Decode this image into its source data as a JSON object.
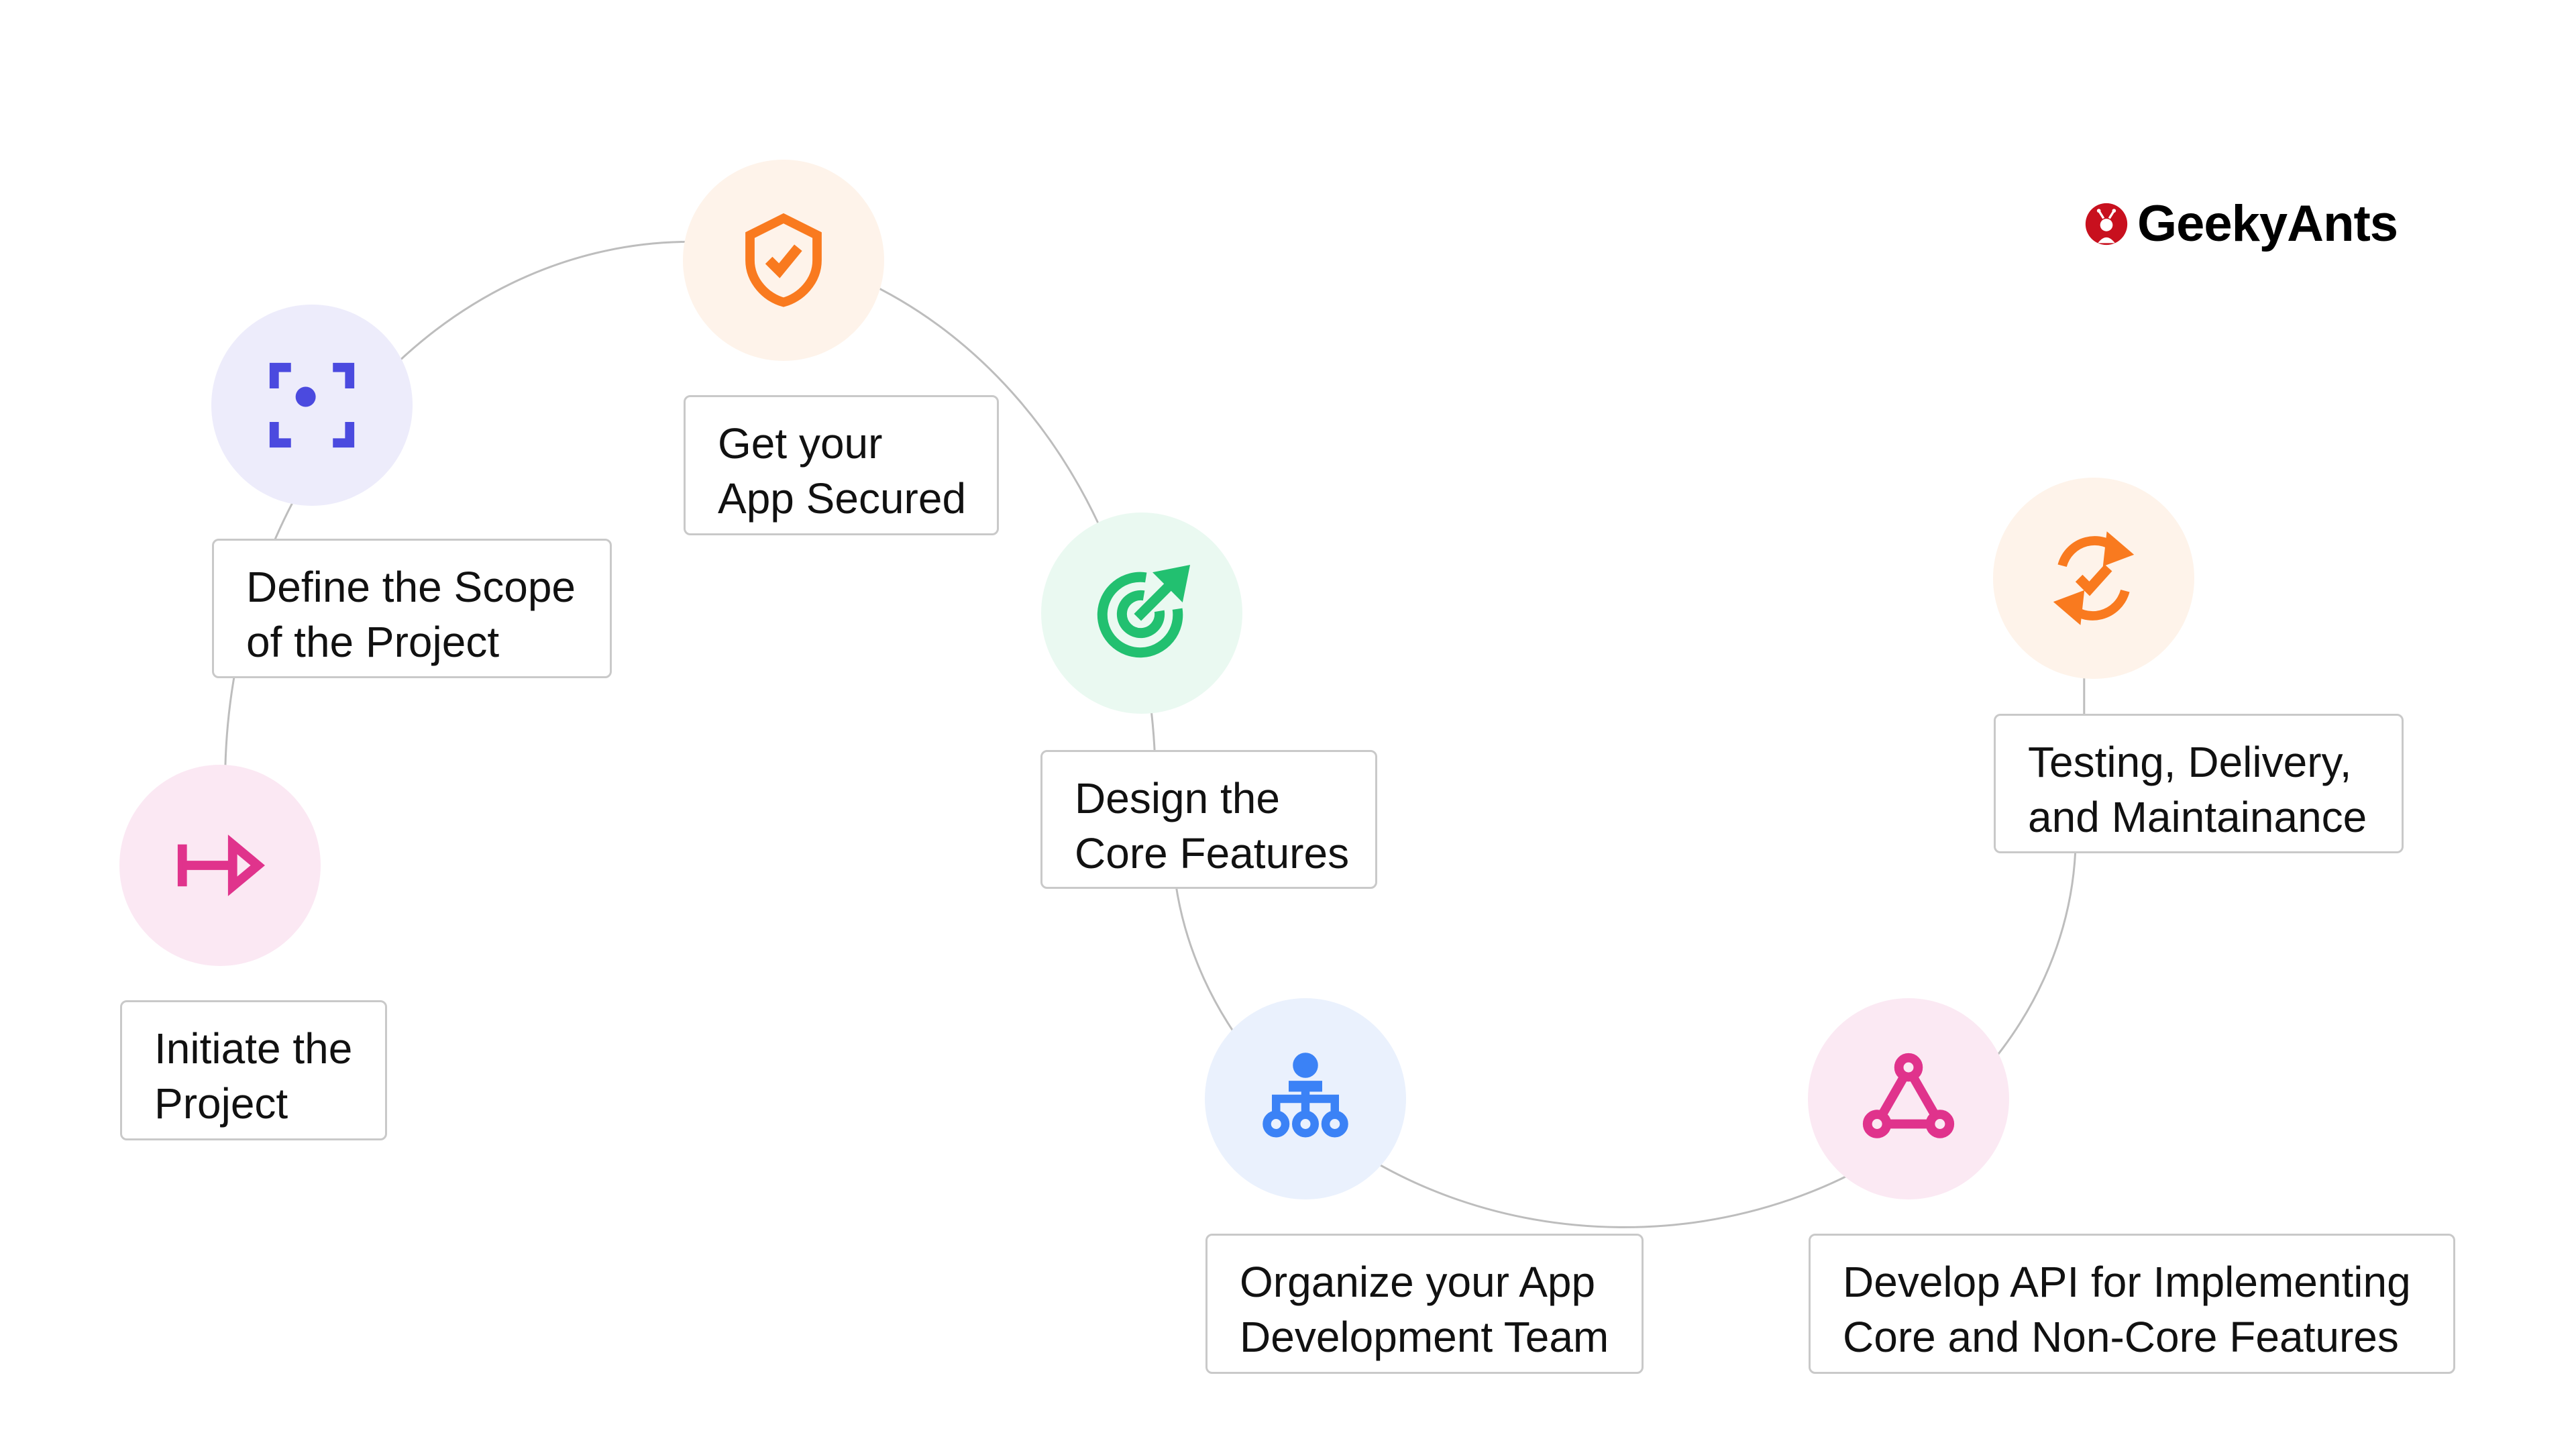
{
  "brand": {
    "name": "GeekyAnts",
    "logo_color": "#C8101E"
  },
  "steps": [
    {
      "id": "initiate",
      "lines": [
        "Initiate the",
        "Project"
      ],
      "icon": "arrow-right-to-icon",
      "color": "#E0338C",
      "bg": "#FBE8F3"
    },
    {
      "id": "define",
      "lines": [
        "Define the Scope",
        "of the Project"
      ],
      "icon": "focus-target-icon",
      "color": "#4B4ADF",
      "bg": "#EDECFB"
    },
    {
      "id": "secure",
      "lines": [
        "Get your",
        "App Secured"
      ],
      "icon": "shield-check-icon",
      "color": "#F97A1F",
      "bg": "#FEF3EA"
    },
    {
      "id": "design",
      "lines": [
        "Design the",
        "Core Features"
      ],
      "icon": "target-arrow-icon",
      "color": "#22C070",
      "bg": "#EAF9F1"
    },
    {
      "id": "organize",
      "lines": [
        "Organize your App",
        "Development Team"
      ],
      "icon": "team-hierarchy-icon",
      "color": "#3B82F6",
      "bg": "#EAF1FD"
    },
    {
      "id": "api",
      "lines": [
        "Develop API for Implementing",
        "Core and Non-Core Features"
      ],
      "icon": "api-nodes-icon",
      "color": "#E0338C",
      "bg": "#FBE9F3"
    },
    {
      "id": "testing",
      "lines": [
        "Testing, Delivery,",
        "and Maintainance"
      ],
      "icon": "refresh-check-icon",
      "color": "#F97A1F",
      "bg": "#FEF3EA"
    }
  ]
}
